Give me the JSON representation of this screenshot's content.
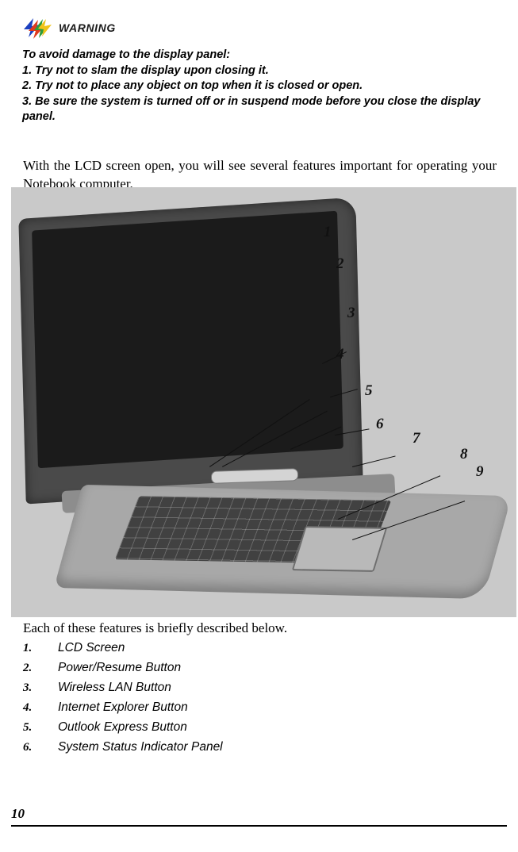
{
  "warning": {
    "icon": "warning-lightning-icon",
    "label": "WARNING",
    "lines": [
      "To avoid damage to the display panel:",
      "1. Try not to slam the display upon closing it.",
      "2. Try not to place any object on top when it is closed or open.",
      "3. Be sure the system is turned off or in suspend mode before you close the display panel."
    ]
  },
  "intro": {
    "paragraph": "With the LCD screen open, you will see several features important for operating your Notebook computer."
  },
  "figure": {
    "caption": "Notebook computer with LCD screen open, numbered callouts 1 through 9",
    "callouts": [
      "1",
      "2",
      "3",
      "4",
      "5",
      "6",
      "7",
      "8",
      "9"
    ]
  },
  "below": {
    "text": "Each of these features is briefly described below."
  },
  "features": [
    {
      "num": "1.",
      "label": "LCD Screen"
    },
    {
      "num": "2.",
      "label": "Power/Resume Button"
    },
    {
      "num": "3.",
      "label": "Wireless LAN Button"
    },
    {
      "num": "4.",
      "label": "Internet Explorer Button"
    },
    {
      "num": "5.",
      "label": "Outlook Express Button"
    },
    {
      "num": "6.",
      "label": "System Status Indicator Panel"
    }
  ],
  "footer": {
    "page_number": "10"
  },
  "colors": {
    "text": "#000000",
    "figure_background": "#c9c9c9",
    "rule": "#000000"
  }
}
